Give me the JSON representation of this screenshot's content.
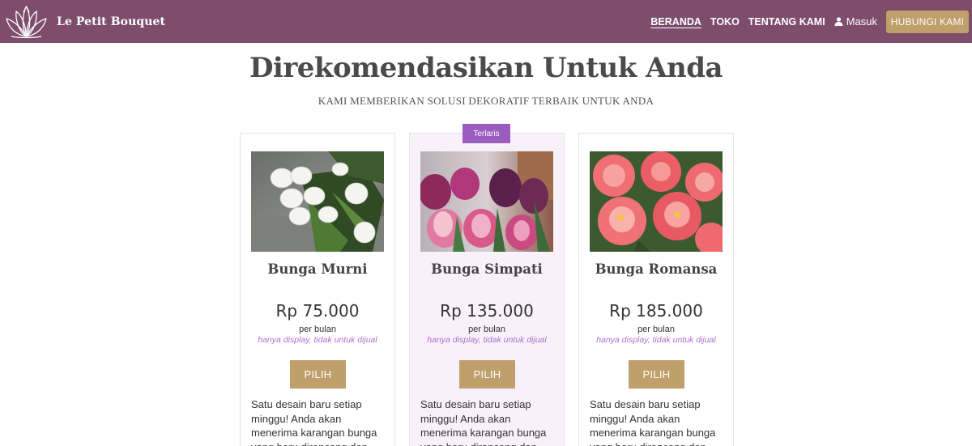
{
  "brand": {
    "name": "Le Petit Bouquet",
    "logo_icon": "lotus-logo-icon"
  },
  "nav": {
    "items": [
      {
        "label": "BERANDA",
        "active": true
      },
      {
        "label": "TOKO",
        "active": false
      },
      {
        "label": "TENTANG KAMI",
        "active": false
      }
    ],
    "login_label": "Masuk",
    "login_icon": "user-icon",
    "cta_label": "HUBUNGI KAMI"
  },
  "main": {
    "title": "Direkomendasikan Untuk Anda",
    "subtitle": "KAMI MEMBERIKAN SOLUSI DEKORATIF TERBAIK UNTUK ANDA"
  },
  "cards": [
    {
      "title": "Bunga Murni",
      "price": "Rp 75.000",
      "period": "per bulan",
      "note": "hanya display, tidak untuk dijual",
      "button": "PILIH",
      "description": "Satu desain baru setiap minggu! Anda akan menerima karangan bunga yang baru dirancang dan",
      "image": "white-tulips-image"
    },
    {
      "title": "Bunga Simpati",
      "price": "Rp 135.000",
      "period": "per bulan",
      "note": "hanya display, tidak untuk dijual",
      "button": "PILIH",
      "description": "Satu desain baru setiap minggu! Anda akan menerima karangan bunga yang baru dirancang dan",
      "image": "pink-tulips-image",
      "badge": "Terlaris"
    },
    {
      "title": "Bunga Romansa",
      "price": "Rp 185.000",
      "period": "per bulan",
      "note": "hanya display, tidak untuk dijual",
      "button": "PILIH",
      "description": "Satu desain baru setiap minggu! Anda akan menerima karangan bunga yang baru dirancang dan",
      "image": "coral-peonies-image"
    }
  ],
  "colors": {
    "navbar": "#7d4d6b",
    "accent_gold": "#bf9f6a",
    "badge_purple": "#9b5cbf",
    "note_purple": "#b06fcc",
    "featured_bg": "#f8f1f9"
  }
}
